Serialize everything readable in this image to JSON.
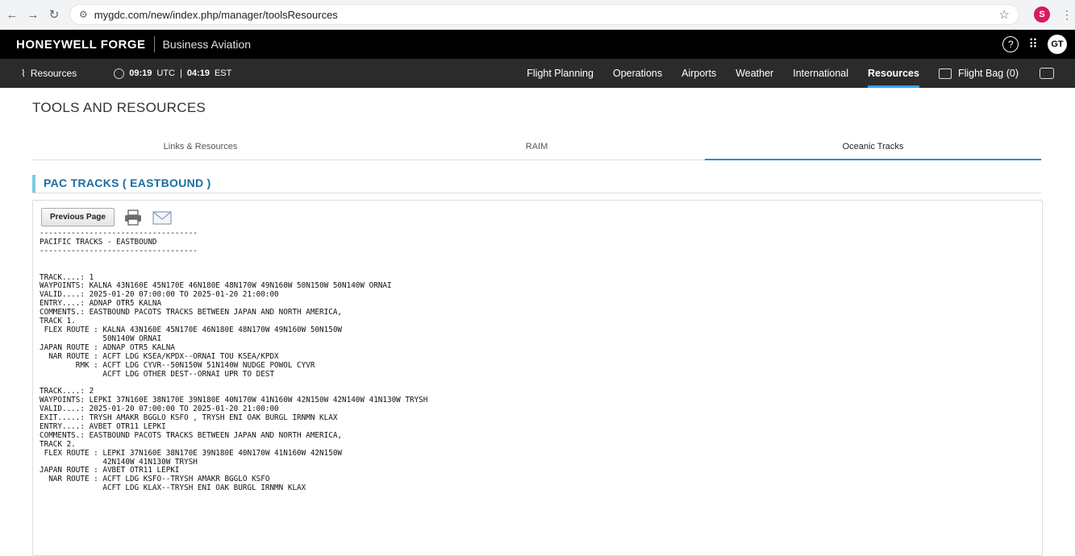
{
  "browser": {
    "url": "mygdc.com/new/index.php/manager/toolsResources",
    "profile_initial": "S"
  },
  "header": {
    "brand": "HONEYWELL FORGE",
    "subtitle": "Business Aviation",
    "avatar_initials": "GT"
  },
  "nav": {
    "resources_label": "Resources",
    "utc_time": "09:19",
    "utc_label": "UTC",
    "est_time": "04:19",
    "est_label": "EST",
    "items": [
      "Flight Planning",
      "Operations",
      "Airports",
      "Weather",
      "International",
      "Resources",
      "Flight Bag (0)"
    ]
  },
  "page": {
    "title": "TOOLS AND RESOURCES",
    "tabs": [
      "Links & Resources",
      "RAIM",
      "Oceanic Tracks"
    ],
    "active_tab": "Oceanic Tracks",
    "section_title": "PAC TRACKS ( EASTBOUND )",
    "previous_button": "Previous Page"
  },
  "tracks_text": "-----------------------------------\nPACIFIC TRACKS - EASTBOUND\n-----------------------------------\n\n\nTRACK....: 1\nWAYPOINTS: KALNA 43N160E 45N170E 46N180E 48N170W 49N160W 50N150W 50N140W ORNAI\nVALID....: 2025-01-20 07:00:00 TO 2025-01-20 21:00:00\nENTRY....: ADNAP OTR5 KALNA\nCOMMENTS.: EASTBOUND PACOTS TRACKS BETWEEN JAPAN AND NORTH AMERICA,\nTRACK 1.\n FLEX ROUTE : KALNA 43N160E 45N170E 46N180E 48N170W 49N160W 50N150W\n              50N140W ORNAI\nJAPAN ROUTE : ADNAP OTR5 KALNA\n  NAR ROUTE : ACFT LDG KSEA/KPDX--ORNAI TOU KSEA/KPDX\n        RMK : ACFT LDG CYVR--50N150W 51N140W NUDGE POWOL CYVR\n              ACFT LDG OTHER DEST--ORNAI UPR TO DEST\n\nTRACK....: 2\nWAYPOINTS: LEPKI 37N160E 38N170E 39N180E 40N170W 41N160W 42N150W 42N140W 41N130W TRYSH\nVALID....: 2025-01-20 07:00:00 TO 2025-01-20 21:00:00\nEXIT.....: TRYSH AMAKR BGGLO KSFO , TRYSH ENI OAK BURGL IRNMN KLAX\nENTRY....: AVBET OTR11 LEPKI\nCOMMENTS.: EASTBOUND PACOTS TRACKS BETWEEN JAPAN AND NORTH AMERICA,\nTRACK 2.\n FLEX ROUTE : LEPKI 37N160E 38N170E 39N180E 40N170W 41N160W 42N150W\n              42N140W 41N130W TRYSH\nJAPAN ROUTE : AVBET OTR11 LEPKI\n  NAR ROUTE : ACFT LDG KSFO--TRYSH AMAKR BGGLO KSFO\n              ACFT LDG KLAX--TRYSH ENI OAK BURGL IRNMN KLAX"
}
